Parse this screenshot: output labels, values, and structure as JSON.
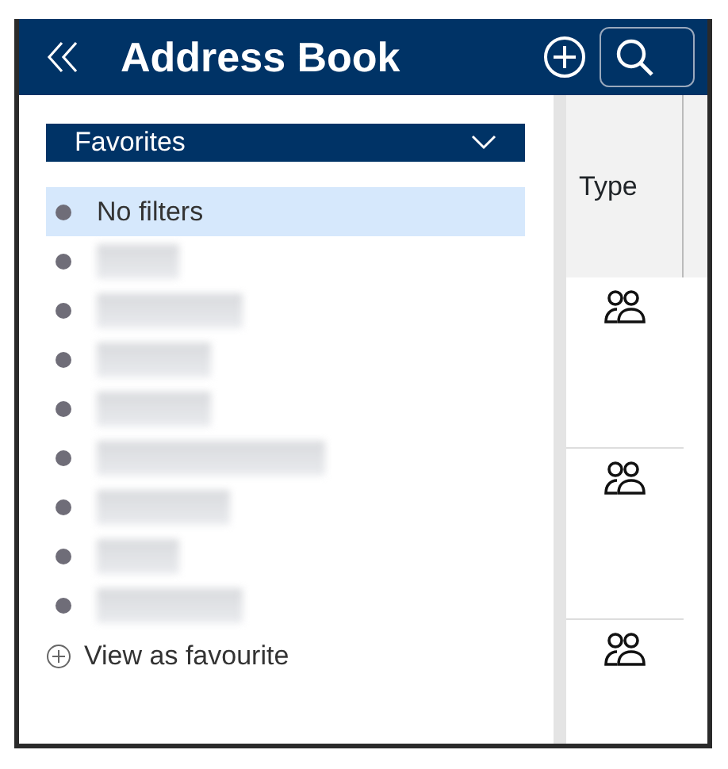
{
  "header": {
    "title": "Address Book"
  },
  "favorites_dropdown": {
    "label": "Favorites",
    "expanded": false
  },
  "filters": [
    {
      "kind": "text",
      "label": "No filters",
      "selected": true
    },
    {
      "kind": "blurred",
      "selected": false
    },
    {
      "kind": "blurred",
      "selected": false
    },
    {
      "kind": "blurred",
      "selected": false
    },
    {
      "kind": "blurred",
      "selected": false
    },
    {
      "kind": "blurred",
      "selected": false
    },
    {
      "kind": "blurred",
      "selected": false
    },
    {
      "kind": "blurred",
      "selected": false
    },
    {
      "kind": "blurred",
      "selected": false
    }
  ],
  "add_favourite": {
    "label": "View as favourite"
  },
  "table": {
    "columns": [
      {
        "label": "Type"
      }
    ],
    "rows": [
      {
        "kind": "group"
      },
      {
        "kind": "group"
      },
      {
        "kind": "group"
      }
    ]
  }
}
